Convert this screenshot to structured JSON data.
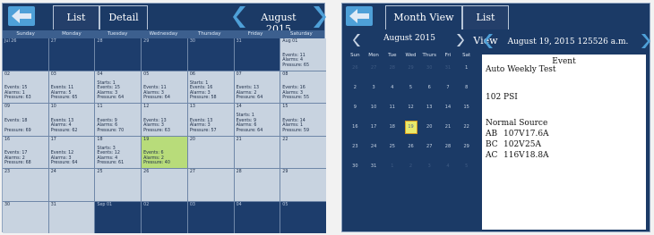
{
  "left": {
    "tabs": [
      "List View",
      "Detail View"
    ],
    "month_title": "August 2015",
    "day_names": [
      "Sunday",
      "Monday",
      "Tuesday",
      "Wednesday",
      "Thursday",
      "Friday",
      "Saturday"
    ],
    "weeks": [
      [
        {
          "num": "Jul 26",
          "info": [],
          "state": "out"
        },
        {
          "num": "27",
          "info": [],
          "state": "out"
        },
        {
          "num": "28",
          "info": [],
          "state": "out"
        },
        {
          "num": "29",
          "info": [],
          "state": "out"
        },
        {
          "num": "30",
          "info": [],
          "state": "out"
        },
        {
          "num": "31",
          "info": [],
          "state": "out"
        },
        {
          "num": "Aug 01",
          "info": [
            "Events: 11",
            "Alarms: 4",
            "Pressure: 65"
          ],
          "state": "in"
        }
      ],
      [
        {
          "num": "02",
          "info": [
            "Events: 15",
            "Alarms: 1",
            "Pressure: 63"
          ],
          "state": "in"
        },
        {
          "num": "03",
          "info": [
            "Events: 11",
            "Alarms: 5",
            "Pressure: 65"
          ],
          "state": "in"
        },
        {
          "num": "04",
          "info": [
            "Starts: 1",
            "Events: 15",
            "Alarms: 3",
            "Pressure: 64"
          ],
          "state": "in"
        },
        {
          "num": "05",
          "info": [
            "Events: 11",
            "Alarms: 3",
            "Pressure: 64"
          ],
          "state": "in"
        },
        {
          "num": "06",
          "info": [
            "Starts: 1",
            "Events: 16",
            "Alarms: 3",
            "Pressure: 58"
          ],
          "state": "in"
        },
        {
          "num": "07",
          "info": [
            "Events: 13",
            "Alarms: 2",
            "Pressure: 64"
          ],
          "state": "in"
        },
        {
          "num": "08",
          "info": [
            "Events: 16",
            "Alarms: 3",
            "Pressure: 55"
          ],
          "state": "in"
        }
      ],
      [
        {
          "num": "09",
          "info": [
            "Events: 18",
            "",
            "Pressure: 69"
          ],
          "state": "in"
        },
        {
          "num": "10",
          "info": [
            "Events: 13",
            "Alarms: 4",
            "Pressure: 62"
          ],
          "state": "in"
        },
        {
          "num": "11",
          "info": [
            "Events: 9",
            "Alarms: 6",
            "Pressure: 70"
          ],
          "state": "in"
        },
        {
          "num": "12",
          "info": [
            "Events: 13",
            "Alarms: 3",
            "Pressure: 63"
          ],
          "state": "in"
        },
        {
          "num": "13",
          "info": [
            "Events: 13",
            "Alarms: 3",
            "Pressure: 57"
          ],
          "state": "in"
        },
        {
          "num": "14",
          "info": [
            "Starts: 1",
            "Events: 9",
            "Alarms: 6",
            "Pressure: 64"
          ],
          "state": "in"
        },
        {
          "num": "15",
          "info": [
            "Events: 14",
            "Alarms: 1",
            "Pressure: 59"
          ],
          "state": "in"
        }
      ],
      [
        {
          "num": "16",
          "info": [
            "Events: 17",
            "Alarms: 2",
            "Pressure: 68"
          ],
          "state": "in"
        },
        {
          "num": "17",
          "info": [
            "Events: 12",
            "Alarms: 3",
            "Pressure: 64"
          ],
          "state": "in"
        },
        {
          "num": "18",
          "info": [
            "Starts: 3",
            "Events: 12",
            "Alarms: 4",
            "Pressure: 61"
          ],
          "state": "in"
        },
        {
          "num": "19",
          "info": [
            "Events: 6",
            "Alarms: 2",
            "Pressure: 40"
          ],
          "state": "today"
        },
        {
          "num": "20",
          "info": [],
          "state": "in"
        },
        {
          "num": "21",
          "info": [],
          "state": "in"
        },
        {
          "num": "22",
          "info": [],
          "state": "in"
        }
      ],
      [
        {
          "num": "23",
          "info": [],
          "state": "in"
        },
        {
          "num": "24",
          "info": [],
          "state": "in"
        },
        {
          "num": "25",
          "info": [],
          "state": "in"
        },
        {
          "num": "26",
          "info": [],
          "state": "in"
        },
        {
          "num": "27",
          "info": [],
          "state": "in"
        },
        {
          "num": "28",
          "info": [],
          "state": "in"
        },
        {
          "num": "29",
          "info": [],
          "state": "in"
        }
      ],
      [
        {
          "num": "30",
          "info": [],
          "state": "in"
        },
        {
          "num": "31",
          "info": [],
          "state": "in"
        },
        {
          "num": "Sep 01",
          "info": [],
          "state": "out"
        },
        {
          "num": "02",
          "info": [],
          "state": "out"
        },
        {
          "num": "03",
          "info": [],
          "state": "out"
        },
        {
          "num": "04",
          "info": [],
          "state": "out"
        },
        {
          "num": "05",
          "info": [],
          "state": "out"
        }
      ]
    ]
  },
  "right": {
    "tabs": [
      "Month View",
      "List View"
    ],
    "mini_month_title": "August 2015",
    "detail_title": "August 19, 2015 125526 a.m.",
    "mini_day_names": [
      "Sun",
      "Mon",
      "Tue",
      "Wed",
      "Thurs",
      "Fri",
      "Sat"
    ],
    "mini_weeks": [
      [
        "26",
        "27",
        "28",
        "29",
        "30",
        "31",
        "1"
      ],
      [
        "2",
        "3",
        "4",
        "5",
        "6",
        "7",
        "8"
      ],
      [
        "9",
        "10",
        "11",
        "12",
        "13",
        "14",
        "15"
      ],
      [
        "16",
        "17",
        "18",
        "19",
        "20",
        "21",
        "22"
      ],
      [
        "23",
        "24",
        "25",
        "26",
        "27",
        "28",
        "29"
      ],
      [
        "30",
        "31",
        "1",
        "2",
        "3",
        "4",
        "5"
      ]
    ],
    "selected_day": "19",
    "event": {
      "heading": "Event",
      "type": "Auto Weekly Test",
      "pressure": "102 PSI",
      "source": "Normal Source",
      "phases": [
        {
          "phase": "AB",
          "volts": "107V",
          "amps": "17.6A"
        },
        {
          "phase": "BC",
          "volts": "102V",
          "amps": "25A"
        },
        {
          "phase": "AC",
          "volts": "116V",
          "amps": "18.8A"
        }
      ]
    }
  },
  "colors": {
    "panel": "#1b3a66",
    "accent": "#4ea0d8",
    "today": "#b8dc7a",
    "selected": "#e9e96a"
  }
}
